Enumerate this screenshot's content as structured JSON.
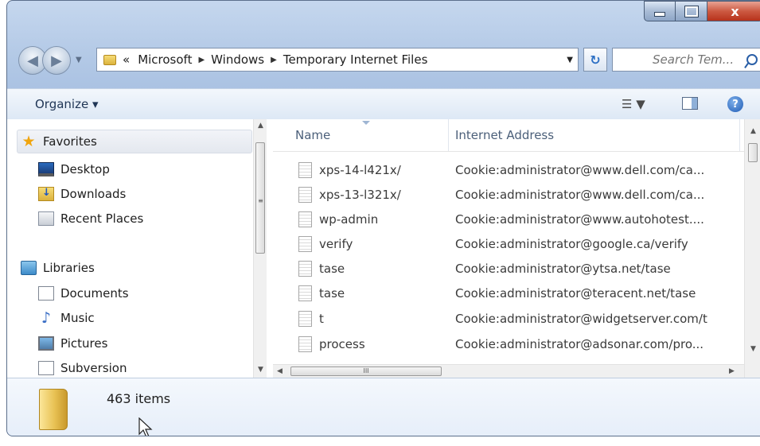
{
  "window": {
    "caption": {
      "minimize": "minimize",
      "maximize": "maximize",
      "close_label": "x"
    }
  },
  "address_bar": {
    "overflow": "«",
    "crumbs": [
      "Microsoft",
      "Windows",
      "Temporary Internet Files"
    ],
    "search_placeholder": "Search Tem..."
  },
  "command_bar": {
    "organize_label": "Organize ▾",
    "view_label": "▼",
    "help_label": "?"
  },
  "navigation_pane": {
    "favorites": {
      "label": "Favorites",
      "items": [
        "Desktop",
        "Downloads",
        "Recent Places"
      ]
    },
    "libraries": {
      "label": "Libraries",
      "items": [
        "Documents",
        "Music",
        "Pictures",
        "Subversion"
      ]
    }
  },
  "file_list": {
    "columns": [
      "Name",
      "Internet Address"
    ],
    "rows": [
      {
        "name": "xps-14-l421x/",
        "address": "Cookie:administrator@www.dell.com/ca..."
      },
      {
        "name": "xps-13-l321x/",
        "address": "Cookie:administrator@www.dell.com/ca..."
      },
      {
        "name": "wp-admin",
        "address": "Cookie:administrator@www.autohotest...."
      },
      {
        "name": "verify",
        "address": "Cookie:administrator@google.ca/verify"
      },
      {
        "name": "tase",
        "address": "Cookie:administrator@ytsa.net/tase"
      },
      {
        "name": "tase",
        "address": "Cookie:administrator@teracent.net/tase"
      },
      {
        "name": "t",
        "address": "Cookie:administrator@widgetserver.com/t"
      },
      {
        "name": "process",
        "address": "Cookie:administrator@adsonar.com/pro..."
      }
    ],
    "hscroll_grip": "III"
  },
  "details_pane": {
    "item_count": "463 items"
  },
  "colors": {
    "chrome": "#b3c9e6",
    "close_button": "#cc5a42",
    "folder": "#e8c153"
  }
}
